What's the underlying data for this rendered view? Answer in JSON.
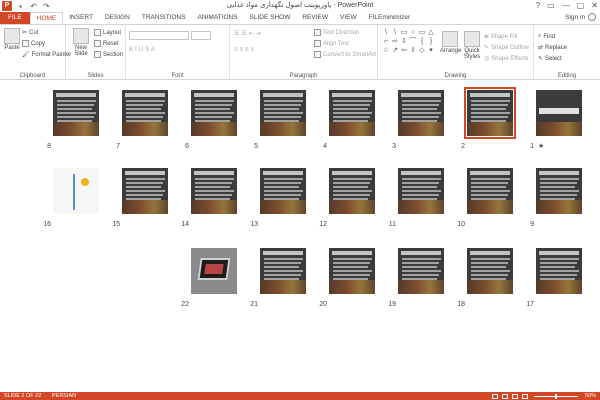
{
  "window": {
    "title": "پاورپوینت اصول نگهداری مواد غذایی - PowerPoint",
    "qat_logo": "P",
    "save_icon": "save-icon",
    "undo_glyph": "↶",
    "redo_glyph": "↷",
    "controls": [
      "?",
      "▭",
      "—",
      "▢",
      "✕"
    ]
  },
  "tabs": [
    "FILE",
    "HOME",
    "INSERT",
    "DESIGN",
    "TRANSITIONS",
    "ANIMATIONS",
    "SLIDE SHOW",
    "REVIEW",
    "VIEW",
    "FILEminimizer"
  ],
  "active_tab": "HOME",
  "signin": "Sign in",
  "ribbon": {
    "clipboard": {
      "label": "Clipboard",
      "paste": "Paste",
      "cut": "Cut",
      "copy": "Copy",
      "format_painter": "Format Painter"
    },
    "slides": {
      "label": "Slides",
      "new_slide": "New Slide",
      "layout": "Layout",
      "reset": "Reset",
      "section": "Section"
    },
    "font": {
      "label": "Font"
    },
    "paragraph": {
      "label": "Paragraph",
      "text_direction": "Text Direction",
      "align_text": "Align Text",
      "convert_smartart": "Convert to SmartArt"
    },
    "drawing": {
      "label": "Drawing",
      "arrange": "Arrange",
      "quick_styles": "Quick Styles",
      "shape_fill": "Shape Fill",
      "shape_outline": "Shape Outline",
      "shape_effects": "Shape Effects"
    },
    "editing": {
      "label": "Editing",
      "find": "Find",
      "replace": "Replace",
      "select": "Select"
    }
  },
  "slides": [
    {
      "num": "1",
      "kind": "title"
    },
    {
      "num": "2",
      "kind": "text",
      "selected": true
    },
    {
      "num": "3",
      "kind": "text"
    },
    {
      "num": "4",
      "kind": "text"
    },
    {
      "num": "5",
      "kind": "text"
    },
    {
      "num": "6",
      "kind": "text"
    },
    {
      "num": "7",
      "kind": "text"
    },
    {
      "num": "8",
      "kind": "text"
    },
    {
      "num": "9",
      "kind": "text"
    },
    {
      "num": "10",
      "kind": "text"
    },
    {
      "num": "11",
      "kind": "text"
    },
    {
      "num": "12",
      "kind": "text"
    },
    {
      "num": "13",
      "kind": "text"
    },
    {
      "num": "14",
      "kind": "text"
    },
    {
      "num": "15",
      "kind": "text"
    },
    {
      "num": "16",
      "kind": "light"
    },
    {
      "num": "17",
      "kind": "text"
    },
    {
      "num": "18",
      "kind": "text"
    },
    {
      "num": "19",
      "kind": "text"
    },
    {
      "num": "20",
      "kind": "text"
    },
    {
      "num": "21",
      "kind": "text"
    },
    {
      "num": "22",
      "kind": "image"
    }
  ],
  "status": {
    "slide_of": "SLIDE 2 OF 22",
    "language": "PERSIAN",
    "zoom": "50%",
    "zoom_value": 50
  }
}
